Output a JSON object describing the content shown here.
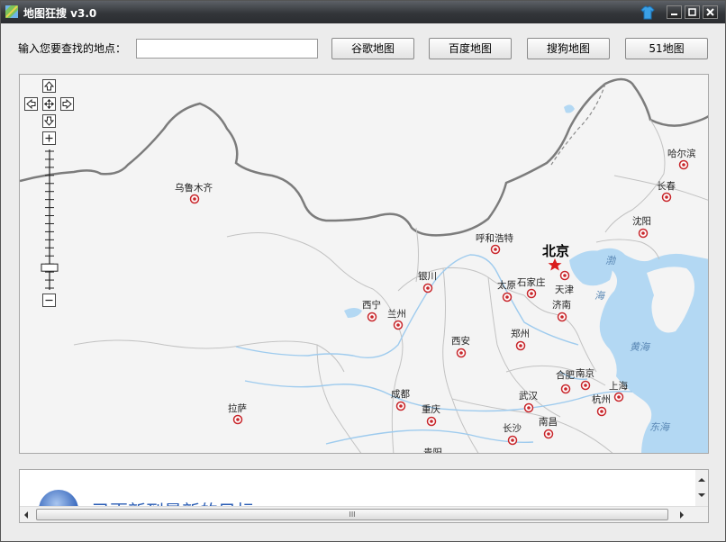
{
  "window": {
    "title": "地图狂搜 v3.0",
    "title_bar_color": "#2f3236"
  },
  "search": {
    "label": "输入您要查找的地点：",
    "value": "",
    "placeholder": ""
  },
  "buttons": {
    "google": "谷歌地图",
    "baidu": "百度地图",
    "sogou": "搜狗地图",
    "map51": "51地图"
  },
  "map": {
    "land_color": "#f4f4f4",
    "sea_color": "#b3d8f3",
    "capital": "北京",
    "cities": [
      {
        "id": "urumqi",
        "name": "乌鲁木齐"
      },
      {
        "id": "harbin",
        "name": "哈尔滨"
      },
      {
        "id": "changchun",
        "name": "长春"
      },
      {
        "id": "shenyang",
        "name": "沈阳"
      },
      {
        "id": "hohhot",
        "name": "呼和浩特"
      },
      {
        "id": "tianjin",
        "name": "天津"
      },
      {
        "id": "shijiazhuang",
        "name": "石家庄"
      },
      {
        "id": "taiyuan",
        "name": "太原"
      },
      {
        "id": "yinchuan",
        "name": "银川"
      },
      {
        "id": "jinan",
        "name": "济南"
      },
      {
        "id": "xining",
        "name": "西宁"
      },
      {
        "id": "lanzhou",
        "name": "兰州"
      },
      {
        "id": "zhengzhou",
        "name": "郑州"
      },
      {
        "id": "xian",
        "name": "西安"
      },
      {
        "id": "hefei",
        "name": "合肥"
      },
      {
        "id": "nanjing",
        "name": "南京"
      },
      {
        "id": "shanghai",
        "name": "上海"
      },
      {
        "id": "chengdu",
        "name": "成都"
      },
      {
        "id": "wuhan",
        "name": "武汉"
      },
      {
        "id": "hangzhou",
        "name": "杭州"
      },
      {
        "id": "lhasa",
        "name": "拉萨"
      },
      {
        "id": "chongqing",
        "name": "重庆"
      },
      {
        "id": "changsha",
        "name": "长沙"
      },
      {
        "id": "nanchang",
        "name": "南昌"
      },
      {
        "id": "guiyang",
        "name": "贵阳"
      }
    ],
    "water_labels": {
      "bohai": "渤",
      "bohai2": "海",
      "yellow_sea": "黄海",
      "east_sea": "东海"
    },
    "zoom_level_fraction": 0.15
  },
  "info": {
    "message": "已更新到最新的目标"
  },
  "scroll": {
    "grip": "III"
  }
}
